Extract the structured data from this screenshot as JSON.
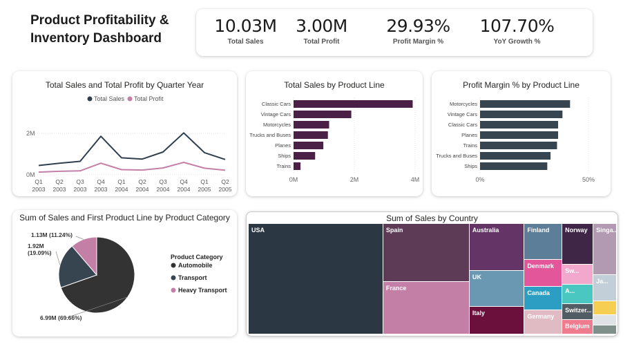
{
  "page": {
    "title": "Product Profitability & Inventory Dashboard"
  },
  "kpis": [
    {
      "value": "10.03M",
      "label": "Total Sales"
    },
    {
      "value": "3.00M",
      "label": "Total Profit"
    },
    {
      "value": "29.93%",
      "label": "Profit Margin %"
    },
    {
      "value": "107.70%",
      "label": "YoY Growth %"
    }
  ],
  "colors": {
    "sales_line": "#2e3f4f",
    "profit_line": "#c47fa6",
    "sales_bar": "#4a2046",
    "margin_bar": "#36454f",
    "pie_automobile": "#333333",
    "pie_transport": "#36454f",
    "pie_heavy": "#c47fa6"
  },
  "chart_data": [
    {
      "type": "line",
      "title": "Total Sales and Total Profit by Quarter Year",
      "categories": [
        [
          "Q1",
          "2003"
        ],
        [
          "Q2",
          "2003"
        ],
        [
          "Q3",
          "2003"
        ],
        [
          "Q4",
          "2003"
        ],
        [
          "Q1",
          "2004"
        ],
        [
          "Q2",
          "2004"
        ],
        [
          "Q3",
          "2004"
        ],
        [
          "Q4",
          "2004"
        ],
        [
          "Q1",
          "2005"
        ],
        [
          "Q2",
          "2005"
        ]
      ],
      "series": [
        {
          "name": "Total Sales",
          "values": [
            0.45,
            0.56,
            0.65,
            1.86,
            0.82,
            0.76,
            1.1,
            2.02,
            1.07,
            0.74
          ]
        },
        {
          "name": "Total Profit",
          "values": [
            0.13,
            0.17,
            0.19,
            0.56,
            0.25,
            0.23,
            0.33,
            0.6,
            0.32,
            0.22
          ]
        }
      ],
      "ylim": [
        0,
        3
      ],
      "yticks": [
        {
          "value": 0,
          "label": "0M"
        },
        {
          "value": 2,
          "label": "2M"
        }
      ],
      "legend": "top-center",
      "grid": true
    },
    {
      "type": "bar",
      "orientation": "horizontal",
      "title": "Total Sales by Product Line",
      "categories": [
        "Classic Cars",
        "Vintage Cars",
        "Motorcycles",
        "Trucks and Buses",
        "Planes",
        "Ships",
        "Trains"
      ],
      "values": [
        3.92,
        1.9,
        1.17,
        1.13,
        0.98,
        0.71,
        0.23
      ],
      "xlim": [
        0,
        4
      ],
      "xticks": [
        {
          "value": 0,
          "label": "0M"
        },
        {
          "value": 2,
          "label": "2M"
        },
        {
          "value": 4,
          "label": "4M"
        }
      ],
      "grid": true
    },
    {
      "type": "bar",
      "orientation": "horizontal",
      "title": "Profit Margin % by Product Line",
      "categories": [
        "Motorcycles",
        "Vintage Cars",
        "Classic Cars",
        "Planes",
        "Trains",
        "Trucks and Buses",
        "Ships"
      ],
      "values": [
        41.5,
        38.0,
        36.0,
        36.0,
        35.5,
        32.5,
        31.0
      ],
      "xlim": [
        0,
        50
      ],
      "xticks": [
        {
          "value": 0,
          "label": "0%"
        },
        {
          "value": 50,
          "label": "50%"
        }
      ],
      "grid": true
    },
    {
      "type": "pie",
      "title": "Sum of Sales and First Product Line by Product Category",
      "legend_title": "Product Category",
      "slices": [
        {
          "name": "Automobile",
          "value": 6.99,
          "label": "6.99M (69.66%)"
        },
        {
          "name": "Transport",
          "value": 1.92,
          "label": "1.92M\n(19.09%)"
        },
        {
          "name": "Heavy Transport",
          "value": 1.13,
          "label": "1.13M (11.24%)"
        }
      ],
      "legend": "right"
    },
    {
      "type": "treemap",
      "title": "Sum of Sales by Country",
      "items": [
        {
          "name": "USA",
          "value": 3.63,
          "color": "#2b3742"
        },
        {
          "name": "Spain",
          "value": 1.22,
          "color": "#5d3a56"
        },
        {
          "name": "France",
          "value": 1.11,
          "color": "#c47fa6"
        },
        {
          "name": "Australia",
          "value": 0.63,
          "color": "#643466"
        },
        {
          "name": "UK",
          "value": 0.48,
          "color": "#6a97b1"
        },
        {
          "name": "Italy",
          "value": 0.37,
          "color": "#6b0f3d"
        },
        {
          "name": "Finland",
          "value": 0.33,
          "color": "#5c7e98"
        },
        {
          "name": "Denmark",
          "value": 0.25,
          "color": "#e4569a"
        },
        {
          "name": "Canada",
          "value": 0.22,
          "color": "#2c9ec4"
        },
        {
          "name": "Germany",
          "value": 0.22,
          "color": "#e0bbc3"
        },
        {
          "name": "Norway",
          "value": 0.31,
          "color": "#3f2646"
        },
        {
          "name": "Singa...",
          "value": 0.29,
          "color": "#b29ab2"
        },
        {
          "name": "Sw...",
          "value": 0.15,
          "color": "#f2a7cc"
        },
        {
          "name": "A...",
          "value": 0.15,
          "color": "#4ac7c0"
        },
        {
          "name": "Ja...",
          "value": 0.15,
          "color": "#c2cfd8"
        },
        {
          "name": "Switzer...",
          "value": 0.12,
          "color": "#515c64"
        },
        {
          "name": "Belgium",
          "value": 0.11,
          "color": "#ef7b8f"
        },
        {
          "name": "",
          "value": 0.08,
          "color": "#f6cf52"
        },
        {
          "name": "",
          "value": 0.06,
          "color": "#dfe3e6"
        },
        {
          "name": "",
          "value": 0.05,
          "color": "#7f8f8a"
        }
      ]
    }
  ]
}
